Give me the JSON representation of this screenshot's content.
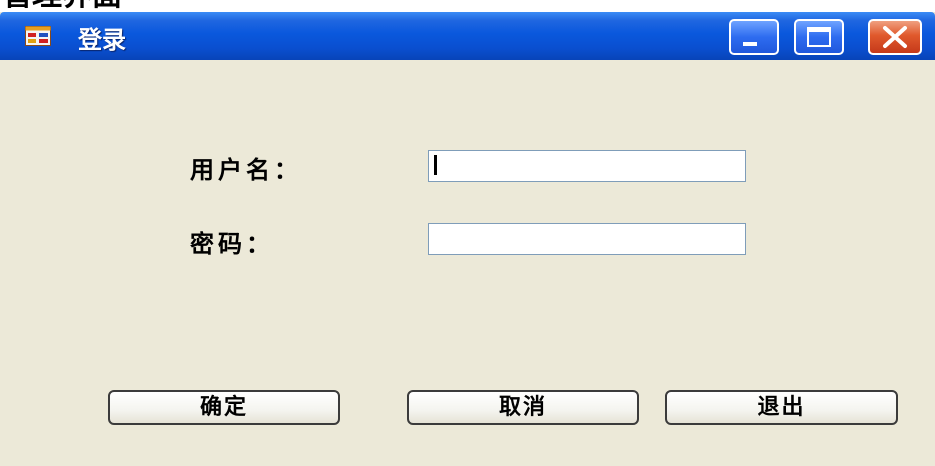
{
  "cropped_heading": "管理界面",
  "window": {
    "title": "登录",
    "icon": "form-window-icon",
    "controls": {
      "minimize_icon": "minimize-icon",
      "maximize_icon": "maximize-icon",
      "close_icon": "close-icon"
    }
  },
  "form": {
    "username_label": "用户名：",
    "username_value": "",
    "password_label": "密码：",
    "password_value": ""
  },
  "buttons": {
    "ok": "确定",
    "cancel": "取消",
    "exit": "退出"
  },
  "colors": {
    "titlebar": "#0a58dd",
    "window_body": "#ece9d8",
    "close_button": "#e0592c"
  }
}
